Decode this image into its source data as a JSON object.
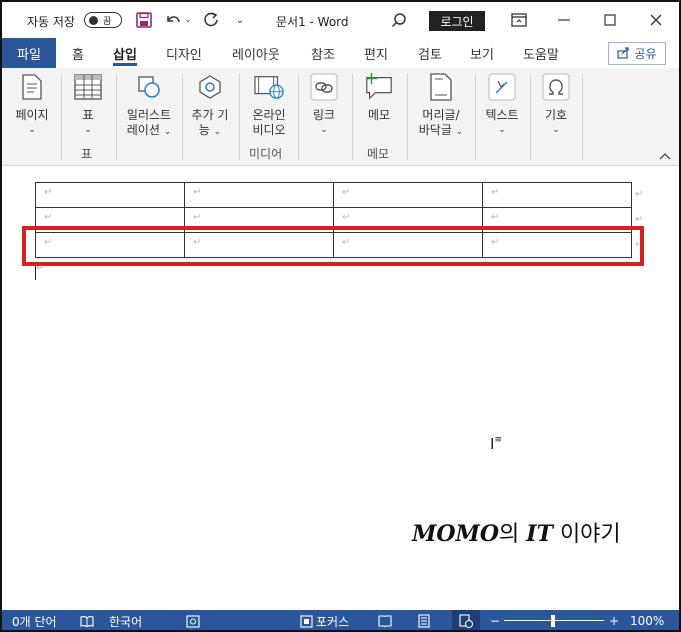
{
  "titlebar": {
    "autosave_label": "자동 저장",
    "autosave_state": "끔",
    "doc_title": "문서1  -  Word",
    "login_label": "로그인"
  },
  "tabs": {
    "file": "파일",
    "items": [
      "홈",
      "삽입",
      "디자인",
      "레이아웃",
      "참조",
      "편지",
      "검토",
      "보기",
      "도움말"
    ],
    "active": "삽입",
    "share_label": "공유"
  },
  "ribbon": {
    "pages": {
      "line1": "페이지",
      "chevron": "⌄"
    },
    "table": {
      "line1": "표",
      "group": "표"
    },
    "illustrations": {
      "line1": "일러스트",
      "line2": "레이션"
    },
    "addins": {
      "line1": "추가 기",
      "line2": "능"
    },
    "online_video": {
      "line1": "온라인",
      "line2": "비디오",
      "group": "미디어"
    },
    "link": {
      "line1": "링크"
    },
    "comment": {
      "line1": "메모",
      "group": "메모"
    },
    "header_footer": {
      "line1": "머리글/",
      "line2": "바닥글"
    },
    "text": {
      "line1": "텍스트"
    },
    "symbols": {
      "line1": "기호"
    }
  },
  "document": {
    "para_mark": "↵",
    "watermark_brand": "MOMO",
    "watermark_mid": "의 ",
    "watermark_it": "IT",
    "watermark_tail": " 이야기"
  },
  "statusbar": {
    "word_count": "0개 단어",
    "language": "한국어",
    "focus": "포커스",
    "zoom": "100%",
    "zoom_minus": "−",
    "zoom_plus": "+"
  },
  "colors": {
    "brand_blue": "#2b579a",
    "highlight_red": "#d52020"
  }
}
